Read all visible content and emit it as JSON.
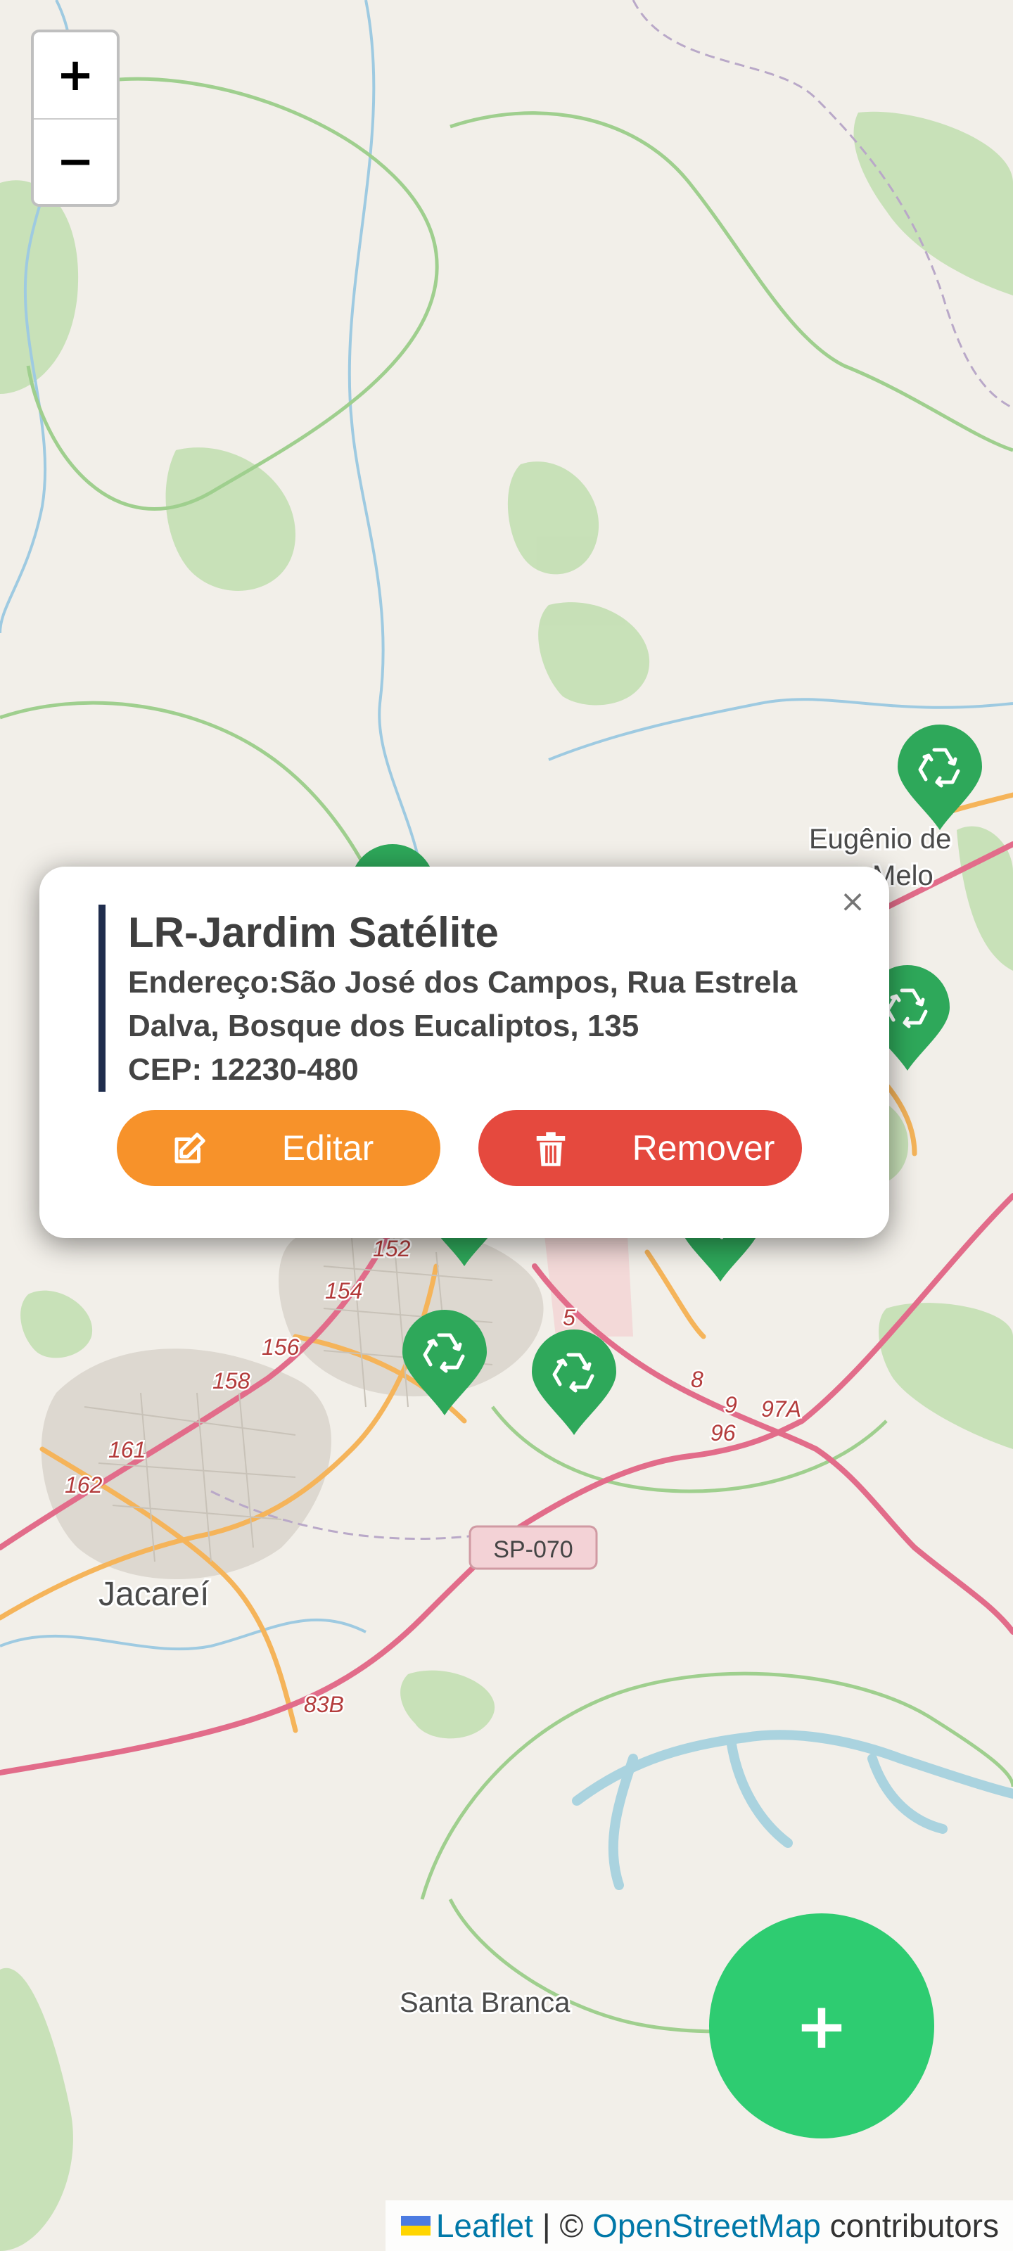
{
  "map": {
    "place_labels": [
      "Eugênio de",
      "Melo",
      "Jacareí",
      "Santa Branca"
    ],
    "road_labels": [
      "SP-070",
      "152",
      "154",
      "156",
      "158",
      "161",
      "162",
      "83B",
      "8",
      "9",
      "96",
      "97A",
      "5"
    ]
  },
  "zoom": {
    "in_label": "+",
    "out_label": "−"
  },
  "markers": {
    "icon": "recycle-icon",
    "color": "#2ea85a",
    "count": 8
  },
  "popup": {
    "title": "LR-Jardim Satélite",
    "address_line1": "Endereço:São José dos Campos, Rua Estrela",
    "address_line2": "Dalva, Bosque dos Eucaliptos, 135",
    "cep": "CEP: 12230-480",
    "close_label": "×",
    "edit_label": "Editar",
    "remove_label": "Remover",
    "accent_color": "#1f2d4d",
    "edit_color": "#f7922a",
    "remove_color": "#e5493e"
  },
  "fab": {
    "label": "+",
    "color": "#2ecc71"
  },
  "attribution": {
    "leaflet": "Leaflet",
    "separator": " | © ",
    "osm": "OpenStreetMap",
    "suffix": " contributors"
  }
}
